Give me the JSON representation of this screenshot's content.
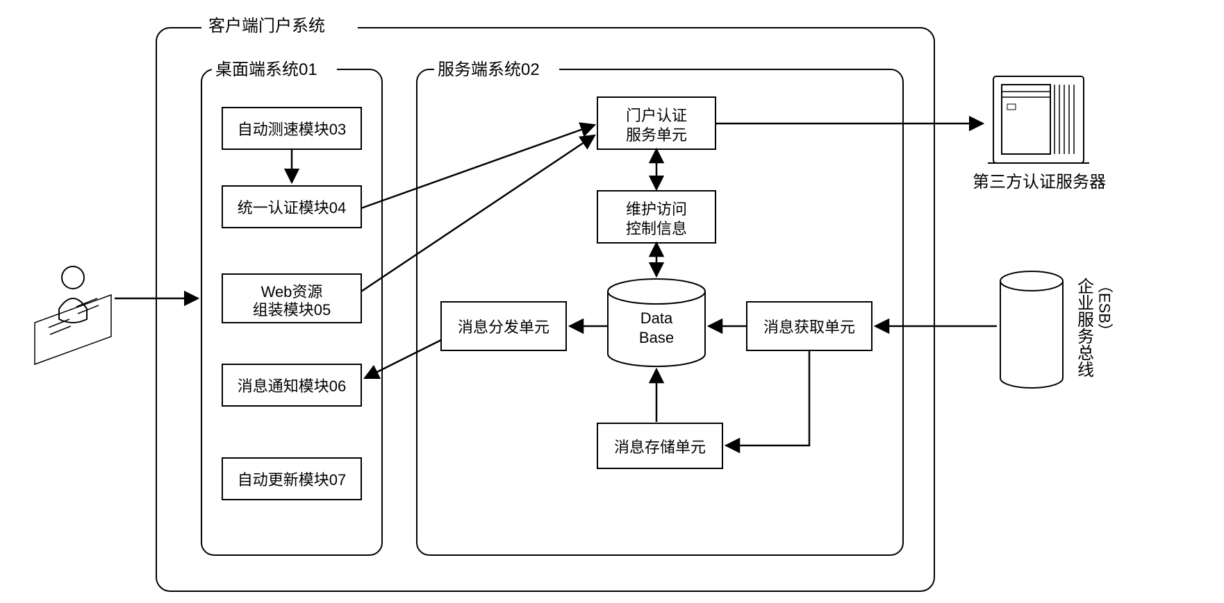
{
  "title": "客户端门户系统",
  "desktop": {
    "title": "桌面端系统01",
    "modules": {
      "speed": "自动测速模块03",
      "auth": "统一认证模块04",
      "web_l1": "Web资源",
      "web_l2": "组装模块05",
      "notify": "消息通知模块06",
      "update": "自动更新模块07"
    }
  },
  "server": {
    "title": "服务端系统02",
    "portal_auth_l1": "门户认证",
    "portal_auth_l2": "服务单元",
    "maintain_l1": "维护访问",
    "maintain_l2": "控制信息",
    "db_l1": "Data",
    "db_l2": "Base",
    "msg_dispatch": "消息分发单元",
    "msg_fetch": "消息获取单元",
    "msg_store": "消息存储单元"
  },
  "external": {
    "third_party": "第三方认证服务器",
    "esb_main": "企业服务总线",
    "esb_sub": "（ESB）"
  }
}
